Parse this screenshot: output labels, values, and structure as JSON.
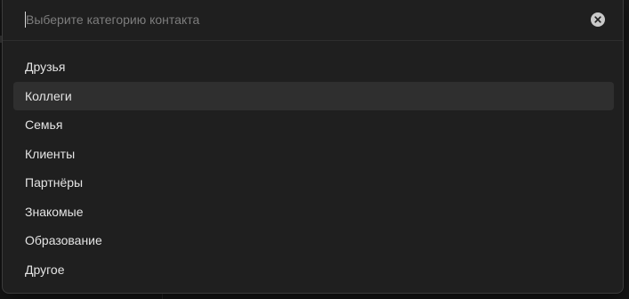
{
  "search": {
    "placeholder": "Выберите категорию контакта",
    "value": ""
  },
  "clear_icon": "close-circle-icon",
  "options": [
    {
      "label": "Друзья",
      "active": false
    },
    {
      "label": "Коллеги",
      "active": true
    },
    {
      "label": "Семья",
      "active": false
    },
    {
      "label": "Клиенты",
      "active": false
    },
    {
      "label": "Партнёры",
      "active": false
    },
    {
      "label": "Знакомые",
      "active": false
    },
    {
      "label": "Образование",
      "active": false
    },
    {
      "label": "Другое",
      "active": false
    }
  ],
  "colors": {
    "panel": "#1f1f1f",
    "highlight": "#2f2f2f",
    "text": "#e4e4e4",
    "placeholder": "#7d7d7d"
  }
}
